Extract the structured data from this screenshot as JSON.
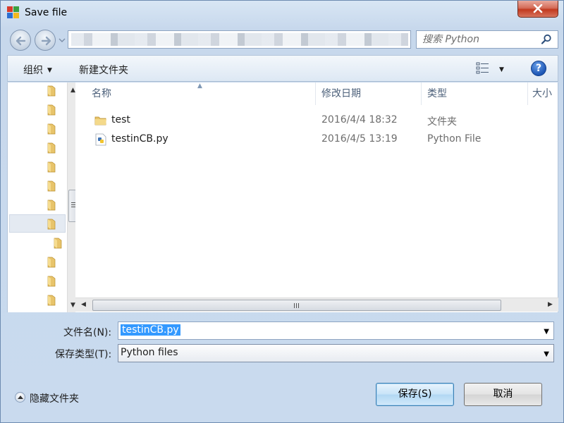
{
  "window": {
    "title": "Save file",
    "close_label": "×"
  },
  "address": {
    "path": "",
    "search_placeholder": "搜索 Python"
  },
  "toolbar": {
    "organize": "组织",
    "new_folder": "新建文件夹"
  },
  "nav_pane": {
    "folder_count": 12,
    "selected_index": 7
  },
  "columns": [
    {
      "label": "名称"
    },
    {
      "label": "修改日期"
    },
    {
      "label": "类型"
    },
    {
      "label": "大小"
    }
  ],
  "files": [
    {
      "name": "test",
      "date": "2016/4/4 18:32",
      "type": "文件夹",
      "icon": "folder-icon"
    },
    {
      "name": "testinCB.py",
      "date": "2016/4/5 13:19",
      "type": "Python File",
      "icon": "python-file-icon"
    }
  ],
  "form": {
    "filename_label": "文件名(N):",
    "filename_value": "testinCB.py",
    "filetype_label": "保存类型(T):",
    "filetype_value": "Python files"
  },
  "footer": {
    "hide_folders": "隐藏文件夹",
    "save_label": "保存(S)",
    "cancel_label": "取消"
  },
  "colors": {
    "selection": "#3399ff",
    "close_button": "#c1391f",
    "folder": "#e8c46b"
  }
}
